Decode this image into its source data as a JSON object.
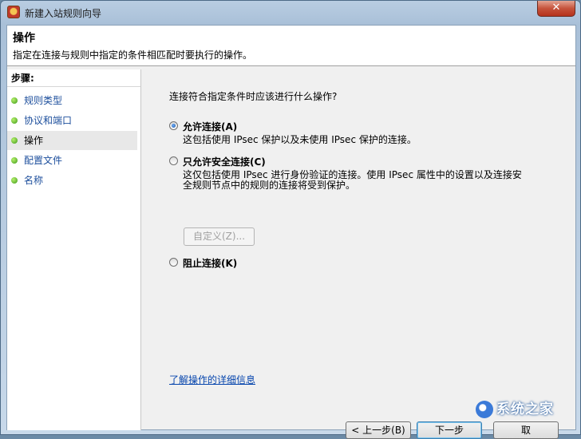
{
  "window": {
    "title": "新建入站规则向导",
    "close_glyph": "✕"
  },
  "header": {
    "title": "操作",
    "description": "指定在连接与规则中指定的条件相匹配时要执行的操作。"
  },
  "sidebar": {
    "heading": "步骤:",
    "steps": [
      {
        "label": "规则类型"
      },
      {
        "label": "协议和端口"
      },
      {
        "label": "操作"
      },
      {
        "label": "配置文件"
      },
      {
        "label": "名称"
      }
    ]
  },
  "main": {
    "question": "连接符合指定条件时应该进行什么操作?",
    "options": [
      {
        "label": "允许连接(A)",
        "description": "这包括使用 IPsec 保护以及未使用 IPsec 保护的连接。",
        "selected": true
      },
      {
        "label": "只允许安全连接(C)",
        "description_line1": "这仅包括使用 IPsec 进行身份验证的连接。使用 IPsec 属性中的设置以及连接安",
        "description_line2": "全规则节点中的规则的连接将受到保护。",
        "selected": false
      },
      {
        "label": "阻止连接(K)",
        "selected": false
      }
    ],
    "customize_button": "自定义(Z)...",
    "learn_more_link": "了解操作的详细信息"
  },
  "footer": {
    "back_button": "< 上一步(B)",
    "next_button": "下一步",
    "cancel_button": "取"
  },
  "watermark": {
    "text": "系统之家"
  },
  "colors": {
    "accent_link": "#0645ad",
    "step_dot": "#3d9a1a",
    "close_button": "#c6533c"
  }
}
